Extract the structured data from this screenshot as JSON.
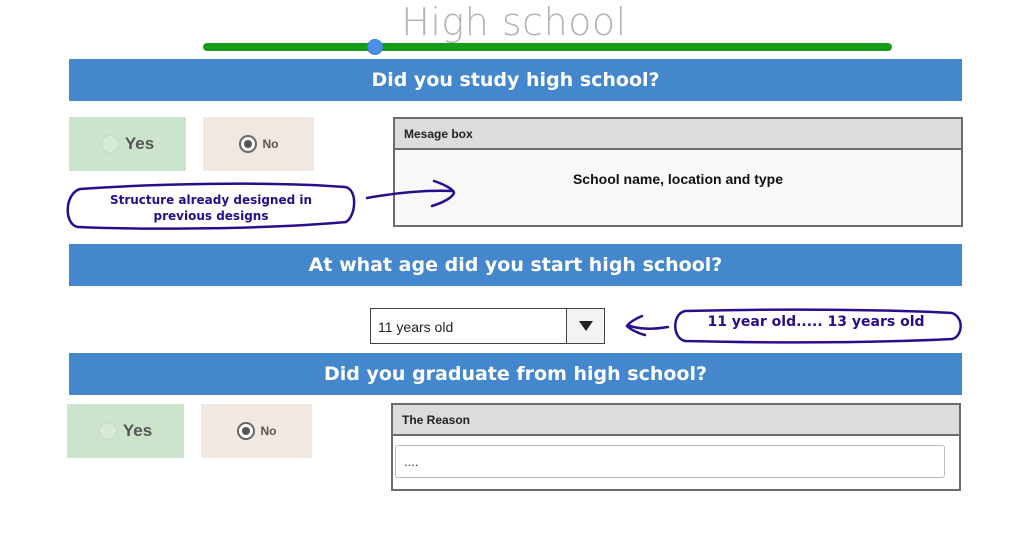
{
  "page": {
    "title": "High school",
    "progress_fraction": 0.25
  },
  "colors": {
    "header_bg": "#4487cc",
    "progress": "#1a9a1a",
    "thumb": "#4a90e8",
    "yes_bg": "#cce3cc",
    "no_bg": "#f1e8e1",
    "annotation_ink": "#2a0d8c"
  },
  "sections": {
    "study": {
      "question": "Did you study high school?",
      "yes_label": "Yes",
      "no_label": "No",
      "selected": "No",
      "message_box": {
        "title": "Mesage box",
        "content": "School name, location and type"
      },
      "annotation": "Structure already designed in previous designs"
    },
    "start_age": {
      "question": "At what age did you start high school?",
      "selected_value": "11 years old",
      "annotation": "11 year old..... 13 years old"
    },
    "graduate": {
      "question": "Did you graduate from high school?",
      "yes_label": "Yes",
      "no_label": "No",
      "selected": "No",
      "reason_box": {
        "title": "The Reason",
        "value": "...."
      }
    }
  },
  "icons": {
    "dropdown": "chevron-down-icon",
    "radio_on": "radio-selected-icon",
    "radio_off": "radio-unselected-icon"
  }
}
